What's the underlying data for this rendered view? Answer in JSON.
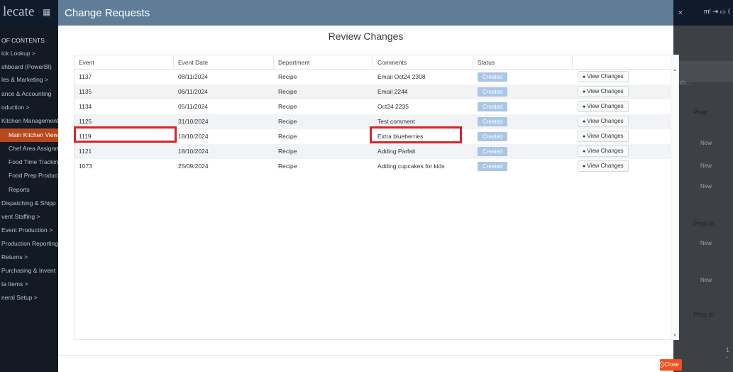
{
  "app": {
    "brand": "lecate",
    "header_right": "m! ⇥ ▭ ⟨",
    "sidebar": [
      {
        "label": "OF CONTENTS",
        "type": "toc"
      },
      {
        "label": "ick Lookup  >",
        "type": "top"
      },
      {
        "label": "shboard (PowerBI)",
        "type": "top"
      },
      {
        "label": "les & Marketing  >",
        "type": "top"
      },
      {
        "label": "ance & Accounting",
        "type": "top"
      },
      {
        "label": "oduction  >",
        "type": "top"
      },
      {
        "label": "Kitchen Management",
        "type": "top"
      },
      {
        "label": "Main Kitchen View",
        "type": "active"
      },
      {
        "label": "Chef Area Assignm",
        "type": "sub"
      },
      {
        "label": "Food Time Tracking",
        "type": "sub"
      },
      {
        "label": "Food Prep Product",
        "type": "sub"
      },
      {
        "label": "Reports",
        "type": "sub"
      },
      {
        "label": "Dispatching & Shipp",
        "type": "top"
      },
      {
        "label": "vent Staffing  >",
        "type": "top"
      },
      {
        "label": "Event Production  >",
        "type": "top"
      },
      {
        "label": "Production Reporting",
        "type": "top"
      },
      {
        "label": "Returns  >",
        "type": "top"
      },
      {
        "label": "Purchasing & Invent",
        "type": "top"
      },
      {
        "label": "ta Items  >",
        "type": "top"
      },
      {
        "label": "neral Setup  >",
        "type": "top"
      }
    ],
    "right_panel": {
      "search": "rch...",
      "prep": "Prep",
      "new": "New",
      "prep_in": "Prep In",
      "pager": "1 -"
    }
  },
  "modal": {
    "title": "Change Requests",
    "close_x": "×",
    "section_title": "Review Changes",
    "columns": [
      "Event",
      "Event Date",
      "Department",
      "Comments",
      "Status",
      ""
    ],
    "rows": [
      {
        "event": "1137",
        "date": "08/11/2024",
        "department": "Recipe",
        "comments": "Email Oct24 2308",
        "status": "Created",
        "action": "View Changes"
      },
      {
        "event": "1135",
        "date": "06/11/2024",
        "department": "Recipe",
        "comments": "Email 2244",
        "status": "Created",
        "action": "View Changes"
      },
      {
        "event": "1134",
        "date": "05/11/2024",
        "department": "Recipe",
        "comments": "Oct24 2235",
        "status": "Created",
        "action": "View Changes"
      },
      {
        "event": "1125",
        "date": "31/10/2024",
        "department": "Recipe",
        "comments": "Test comment",
        "status": "Created",
        "action": "View Changes"
      },
      {
        "event": "1119",
        "date": "18/10/2024",
        "department": "Recipe",
        "comments": "Extra blueberries",
        "status": "Created",
        "action": "View Changes"
      },
      {
        "event": "1121",
        "date": "18/10/2024",
        "department": "Recipe",
        "comments": "Adding Parfait",
        "status": "Created",
        "action": "View Changes"
      },
      {
        "event": "1073",
        "date": "25/09/2024",
        "department": "Recipe",
        "comments": "Adding cupcakes for kids",
        "status": "Created",
        "action": "View Changes"
      }
    ],
    "close_label": "Close",
    "close_icon": "⃠"
  },
  "colors": {
    "modal_header": "#5f7d97",
    "status_badge": "#aac6e6",
    "close_button": "#f0501e",
    "highlight": "#d9242b",
    "active_nav": "#b8491e"
  }
}
